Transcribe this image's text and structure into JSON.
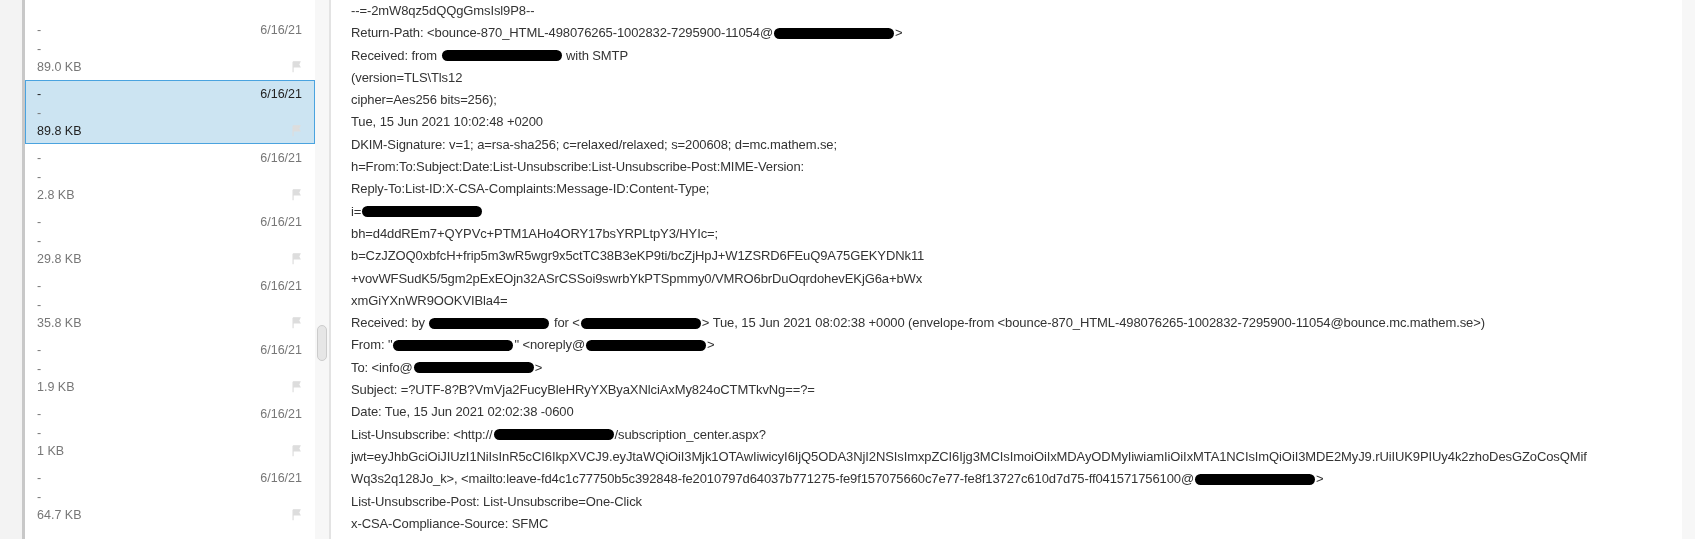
{
  "message_list": [
    {
      "subject": "-",
      "preview": "-",
      "size": "89.0 KB",
      "date": "6/16/21",
      "flagged": false,
      "selected": false
    },
    {
      "subject": "-",
      "preview": "-",
      "size": "89.8 KB",
      "date": "6/16/21",
      "flagged": false,
      "selected": true
    },
    {
      "subject": "-",
      "preview": "-",
      "size": "2.8 KB",
      "date": "6/16/21",
      "flagged": false,
      "selected": false
    },
    {
      "subject": "-",
      "preview": "-",
      "size": "29.8 KB",
      "date": "6/16/21",
      "flagged": false,
      "selected": false
    },
    {
      "subject": "-",
      "preview": "-",
      "size": "35.8 KB",
      "date": "6/16/21",
      "flagged": false,
      "selected": false
    },
    {
      "subject": "-",
      "preview": "-",
      "size": "1.9 KB",
      "date": "6/16/21",
      "flagged": false,
      "selected": false
    },
    {
      "subject": "-",
      "preview": "-",
      "size": "1 KB",
      "date": "6/16/21",
      "flagged": false,
      "selected": false
    },
    {
      "subject": "-",
      "preview": "-",
      "size": "64.7 KB",
      "date": "6/16/21",
      "flagged": false,
      "selected": false
    }
  ],
  "message_source": {
    "lines": [
      [
        {
          "kind": "text",
          "text": "--=-2mW8qz5dQQgGmsIsl9P8--"
        }
      ],
      [
        {
          "kind": "text",
          "text": "Return-Path: <bounce-870_HTML-498076265-1002832-7295900-11054@"
        },
        {
          "kind": "redacted"
        },
        {
          "kind": "text",
          "text": ">"
        }
      ],
      [
        {
          "kind": "text",
          "text": "Received: from "
        },
        {
          "kind": "redacted"
        },
        {
          "kind": "text",
          "text": " with SMTP"
        }
      ],
      [
        {
          "kind": "text",
          "text": "(version=TLS\\Tls12"
        }
      ],
      [
        {
          "kind": "text",
          "text": "cipher=Aes256 bits=256);"
        }
      ],
      [
        {
          "kind": "text",
          "text": "Tue, 15 Jun 2021 10:02:48 +0200"
        }
      ],
      [
        {
          "kind": "text",
          "text": "DKIM-Signature: v=1; a=rsa-sha256; c=relaxed/relaxed; s=200608; d=mc.mathem.se;"
        }
      ],
      [
        {
          "kind": "text",
          "text": "h=From:To:Subject:Date:List-Unsubscribe:List-Unsubscribe-Post:MIME-Version:"
        }
      ],
      [
        {
          "kind": "text",
          "text": "Reply-To:List-ID:X-CSA-Complaints:Message-ID:Content-Type;"
        }
      ],
      [
        {
          "kind": "text",
          "text": "i="
        },
        {
          "kind": "redacted"
        }
      ],
      [
        {
          "kind": "text",
          "text": "bh=d4ddREm7+QYPVc+PTM1AHo4ORY17bsYRPLtpY3/HYIc=;"
        }
      ],
      [
        {
          "kind": "text",
          "text": "b=CzJZOQ0xbfcH+frip5m3wR5wgr9x5ctTC38B3eKP9ti/bcZjHpJ+W1ZSRD6FEuQ9A75GEKYDNk11"
        }
      ],
      [
        {
          "kind": "text",
          "text": "+vovWFSudK5/5gm2pExEOjn32ASrCSSoi9swrbYkPTSpmmy0/VMRO6brDuOqrdohevEKjG6a+bWx"
        }
      ],
      [
        {
          "kind": "text",
          "text": "xmGiYXnWR9OOKVIBla4="
        }
      ],
      [
        {
          "kind": "text",
          "text": "Received: by "
        },
        {
          "kind": "redacted"
        },
        {
          "kind": "text",
          "text": " for <"
        },
        {
          "kind": "redacted"
        },
        {
          "kind": "text",
          "text": "> Tue, 15 Jun 2021 08:02:38 +0000 (envelope-from <bounce-870_HTML-498076265-1002832-7295900-11054@bounce.mc.mathem.se>)"
        }
      ],
      [
        {
          "kind": "text",
          "text": "From: \""
        },
        {
          "kind": "redacted"
        },
        {
          "kind": "text",
          "text": "\" <noreply@"
        },
        {
          "kind": "redacted"
        },
        {
          "kind": "text",
          "text": ">"
        }
      ],
      [
        {
          "kind": "text",
          "text": "To: <info@"
        },
        {
          "kind": "redacted"
        },
        {
          "kind": "text",
          "text": ">"
        }
      ],
      [
        {
          "kind": "text",
          "text": "Subject: =?UTF-8?B?VmVja2FucyBleHRyYXByaXNlciAxMy824oCTMTkvNg==?="
        }
      ],
      [
        {
          "kind": "text",
          "text": "Date: Tue, 15 Jun 2021 02:02:38 -0600"
        }
      ],
      [
        {
          "kind": "text",
          "text": "List-Unsubscribe: <http://"
        },
        {
          "kind": "redacted"
        },
        {
          "kind": "text",
          "text": "/subscription_center.aspx?"
        }
      ],
      [
        {
          "kind": "text",
          "text": "jwt=eyJhbGciOiJIUzI1NiIsInR5cCI6IkpXVCJ9.eyJtaWQiOiI3Mjk1OTAwIiwicyI6IjQ5ODA3NjI2NSIsImxpZCI6Ijg3MCIsImoiOiIxMDAyODMyIiwiamIiOiIxMTA1NCIsImQiOiI3MDE2MyJ9.rUiIUK9PIUy4k2zhoDesGZoCosQMif"
        }
      ],
      [
        {
          "kind": "text",
          "text": "Wq3s2q128Jo_k>, <mailto:leave-fd4c1c77750b5c392848-fe2010797d64037b771275-fe9f157075660c7e77-fe8f13727c610d7d75-ff041571756100@"
        },
        {
          "kind": "redacted"
        },
        {
          "kind": "text",
          "text": ">"
        }
      ],
      [
        {
          "kind": "text",
          "text": "List-Unsubscribe-Post: List-Unsubscribe=One-Click"
        }
      ],
      [
        {
          "kind": "text",
          "text": "x-CSA-Compliance-Source: SFMC"
        }
      ]
    ]
  }
}
